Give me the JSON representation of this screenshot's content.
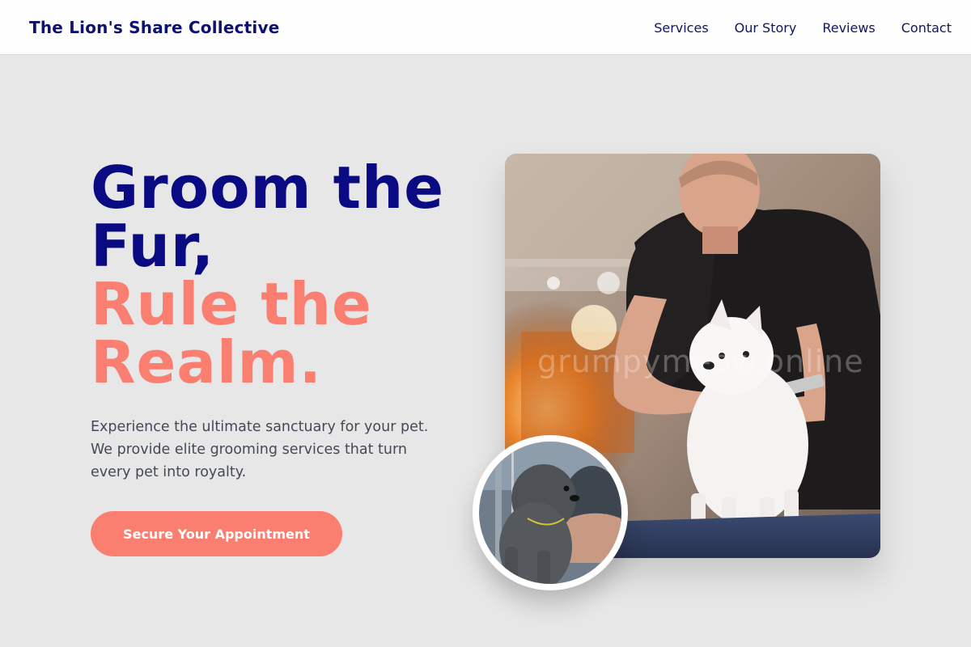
{
  "header": {
    "brand": "The Lion's Share Collective",
    "nav": [
      "Services",
      "Our Story",
      "Reviews",
      "Contact"
    ]
  },
  "hero": {
    "headline_line1": "Groom the Fur,",
    "headline_line2": "Rule the Realm.",
    "description": "Experience the ultimate sanctuary for your pet. We provide elite grooming services that turn every pet into royalty.",
    "cta_label": "Secure Your Appointment"
  },
  "images": {
    "main_watermark": "grumpymeow.online"
  },
  "colors": {
    "navy": "#0a0b82",
    "coral": "#fa7f71",
    "background": "#e7e7e8"
  }
}
